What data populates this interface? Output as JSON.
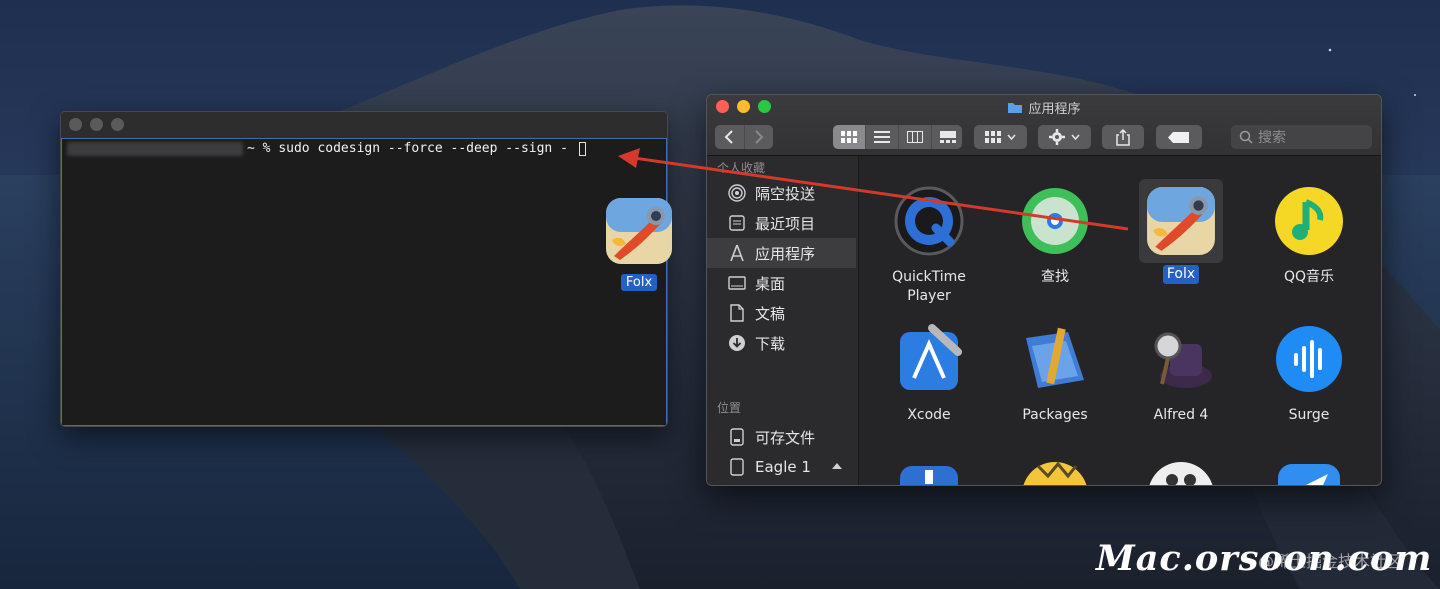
{
  "terminal": {
    "prompt_suffix": "~ % ",
    "command": "sudo codesign --force --deep --sign -"
  },
  "dragged_icon": {
    "label": "Folx"
  },
  "finder": {
    "title": "应用程序",
    "search_placeholder": "搜索",
    "sidebar": {
      "favorites_header": "个人收藏",
      "favorites": [
        {
          "label": "隔空投送",
          "icon": "airdrop-icon"
        },
        {
          "label": "最近项目",
          "icon": "recents-icon"
        },
        {
          "label": "应用程序",
          "icon": "applications-icon",
          "active": true
        },
        {
          "label": "桌面",
          "icon": "desktop-icon"
        },
        {
          "label": "文稿",
          "icon": "documents-icon"
        },
        {
          "label": "下载",
          "icon": "downloads-icon"
        }
      ],
      "locations_header": "位置",
      "locations": [
        {
          "label": "可存文件",
          "icon": "disk-icon"
        },
        {
          "label": "Eagle 1",
          "icon": "disk-icon"
        }
      ]
    },
    "apps": [
      {
        "label": "QuickTime Player",
        "icon": "quicktime-icon"
      },
      {
        "label": "查找",
        "icon": "find-my-icon"
      },
      {
        "label": "Folx",
        "icon": "folx-rocket-icon",
        "selected": true
      },
      {
        "label": "QQ音乐",
        "icon": "qq-music-icon"
      },
      {
        "label": "Xcode",
        "icon": "xcode-icon"
      },
      {
        "label": "Packages",
        "icon": "packages-icon"
      },
      {
        "label": "Alfred 4",
        "icon": "alfred-icon"
      },
      {
        "label": "Surge",
        "icon": "surge-icon"
      }
    ]
  },
  "watermark": {
    "text": "Mac.orsoon.com",
    "secondary": "@稀土掘金技术社区"
  },
  "colors": {
    "accent": "#2461c5",
    "arrow": "#d43a2a"
  }
}
